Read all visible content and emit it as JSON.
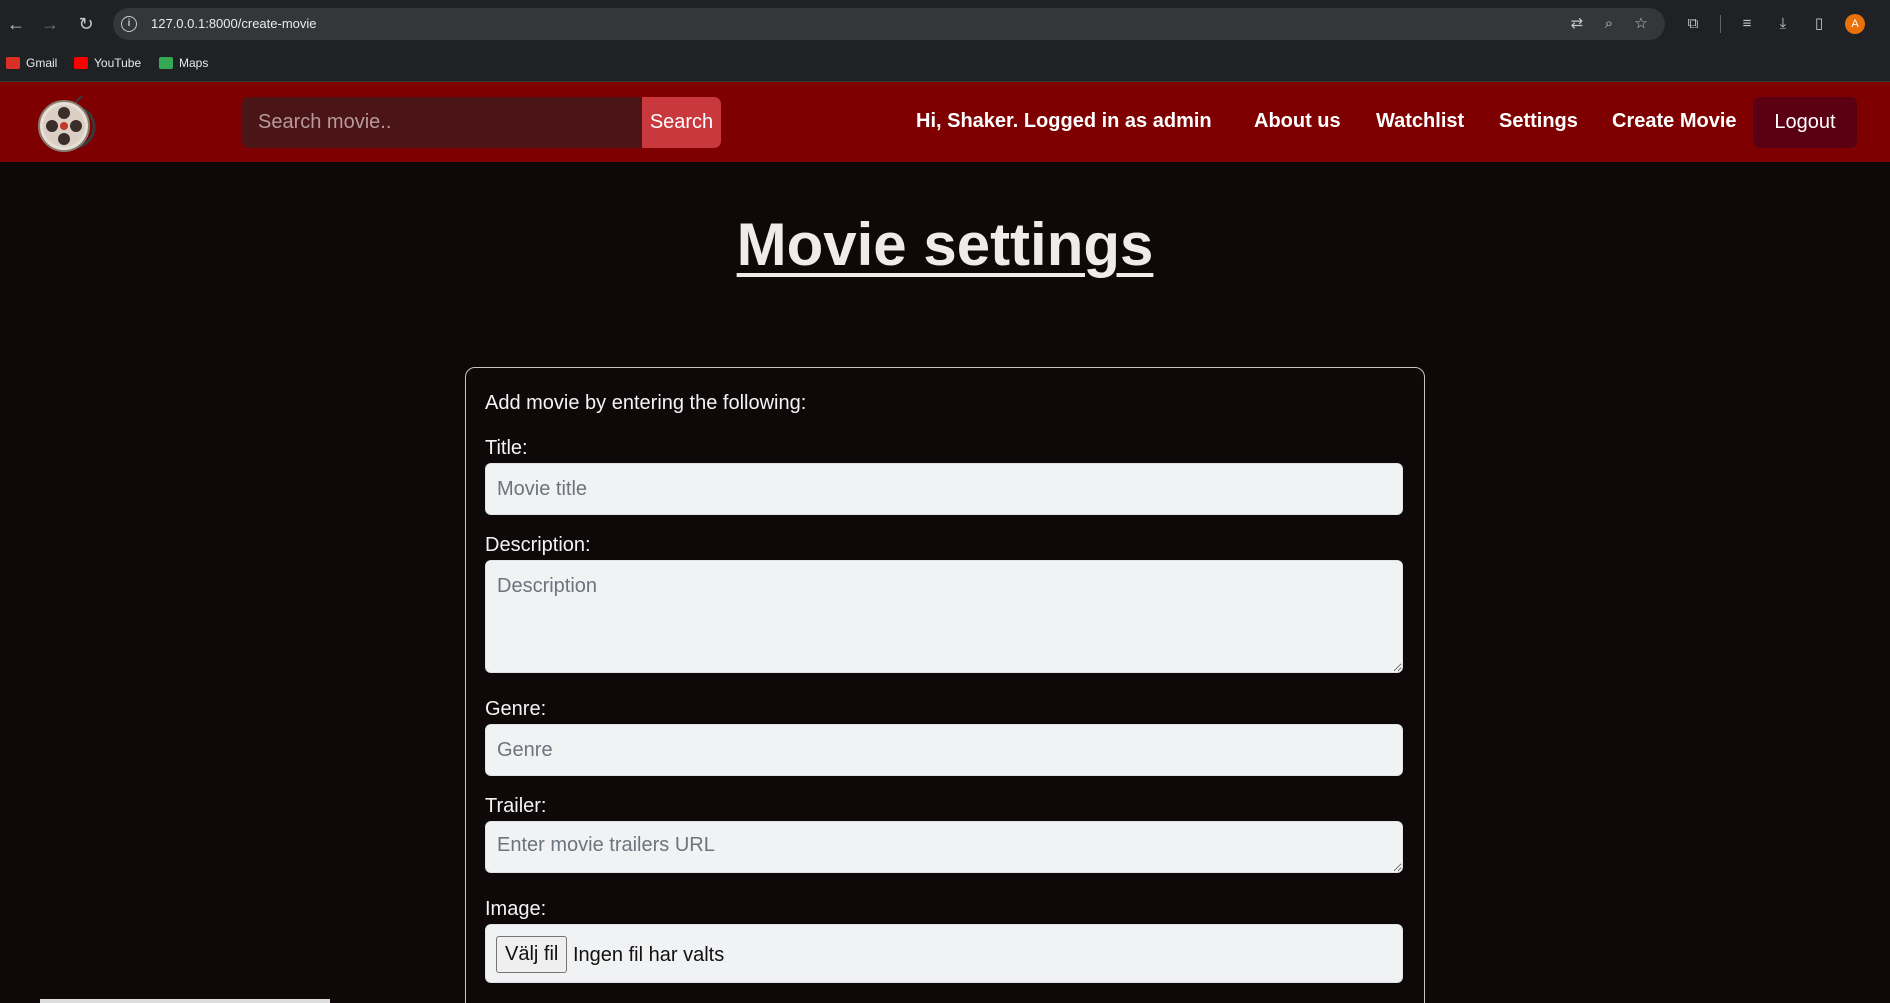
{
  "browser": {
    "url": "127.0.0.1:8000/create-movie",
    "profile_initial": "A",
    "bookmarks": [
      {
        "label": "Gmail",
        "color": "#d93025"
      },
      {
        "label": "YouTube",
        "color": "#ff0000"
      },
      {
        "label": "Maps",
        "color": "#34a853"
      }
    ]
  },
  "navbar": {
    "search_placeholder": "Search movie..",
    "search_button": "Search",
    "greeting": "Hi, Shaker. Logged in as admin",
    "links": [
      "About us",
      "Watchlist",
      "Settings",
      "Create Movie"
    ],
    "logout": "Logout",
    "bg_color": "#7e0000"
  },
  "page": {
    "title": "Movie settings"
  },
  "form": {
    "intro": "Add movie by entering the following:",
    "title_label": "Title:",
    "title_placeholder": "Movie title",
    "description_label": "Description:",
    "description_placeholder": "Description",
    "genre_label": "Genre:",
    "genre_placeholder": "Genre",
    "trailer_label": "Trailer:",
    "trailer_placeholder": "Enter movie trailers URL",
    "image_label": "Image:",
    "file_button": "Välj fil",
    "file_status": "Ingen fil har valts"
  }
}
